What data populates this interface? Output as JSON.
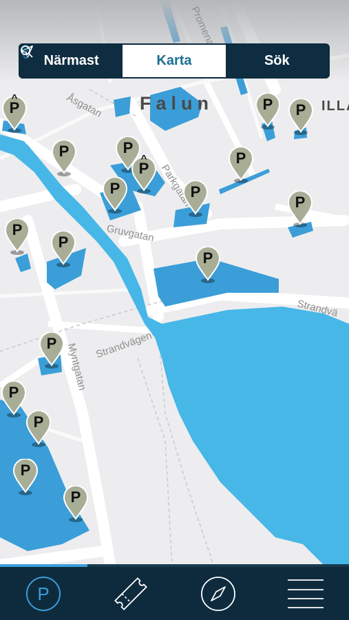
{
  "app": {
    "segments": [
      {
        "label": "Närmast",
        "icon": "navigation-arrow-icon",
        "active": false
      },
      {
        "label": "Karta",
        "icon": "map-pin-icon",
        "active": true
      },
      {
        "label": "Sök",
        "icon": "search-icon",
        "active": false
      }
    ]
  },
  "map": {
    "city": "Falun",
    "city_partial": "ILLAS",
    "streets": {
      "asgatan": "Åsgatan",
      "parkgatan": "Parkgatan",
      "gruvgatan": "Gruvgatan",
      "strandvagen": "Strandvägen",
      "strandvagen_east": "Strandvä",
      "myntgatan": "Myntgatan",
      "promenad": "Promenad"
    },
    "parking_label": "P",
    "parking_covered_mark": "^"
  },
  "bottom_nav": {
    "progress": 0.25,
    "items": [
      "parking-icon",
      "ticket-icon",
      "compass-icon",
      "menu-icon"
    ]
  },
  "colors": {
    "water": "#47b7e8",
    "parking_area": "#3b9ed8",
    "pin": "#a8ad96",
    "nav_bg": "#0e2b3e",
    "accent": "#1c6f93"
  }
}
